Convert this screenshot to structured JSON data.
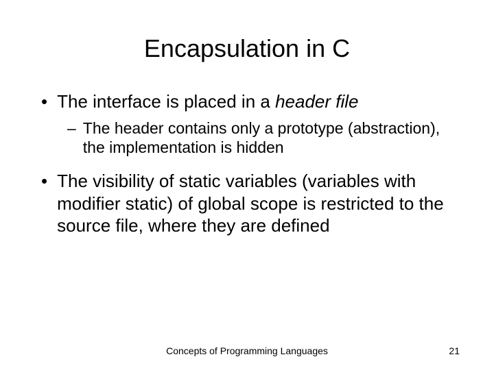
{
  "slide": {
    "title": "Encapsulation in C",
    "bullets": [
      {
        "text_prefix": "The interface is placed in a ",
        "text_italic": "header file",
        "sub": "The header contains only a prototype (abstraction), the implementation is hidden"
      },
      {
        "text": "The visibility of static variables (variables with modifier static) of global scope is restricted to the source file, where they are defined"
      }
    ],
    "footer": "Concepts of Programming Languages",
    "page": "21"
  }
}
